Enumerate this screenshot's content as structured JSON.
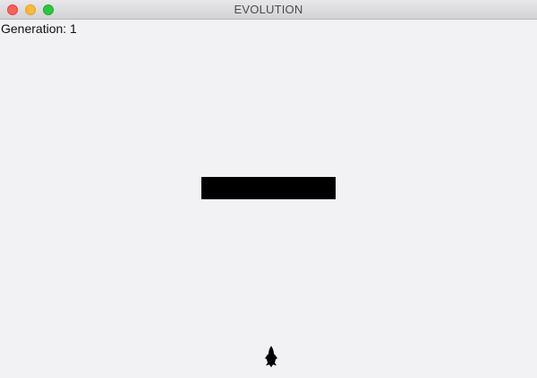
{
  "window": {
    "title": "EVOLUTION",
    "controls": {
      "close_color": "#fc5f57",
      "minimize_color": "#fdbc2e",
      "zoom_color": "#29c840"
    }
  },
  "simulation": {
    "generation_label": "Generation: 1",
    "obstacle_color": "#000000",
    "agent_color": "#000000",
    "background_color": "#f2f1f3"
  }
}
